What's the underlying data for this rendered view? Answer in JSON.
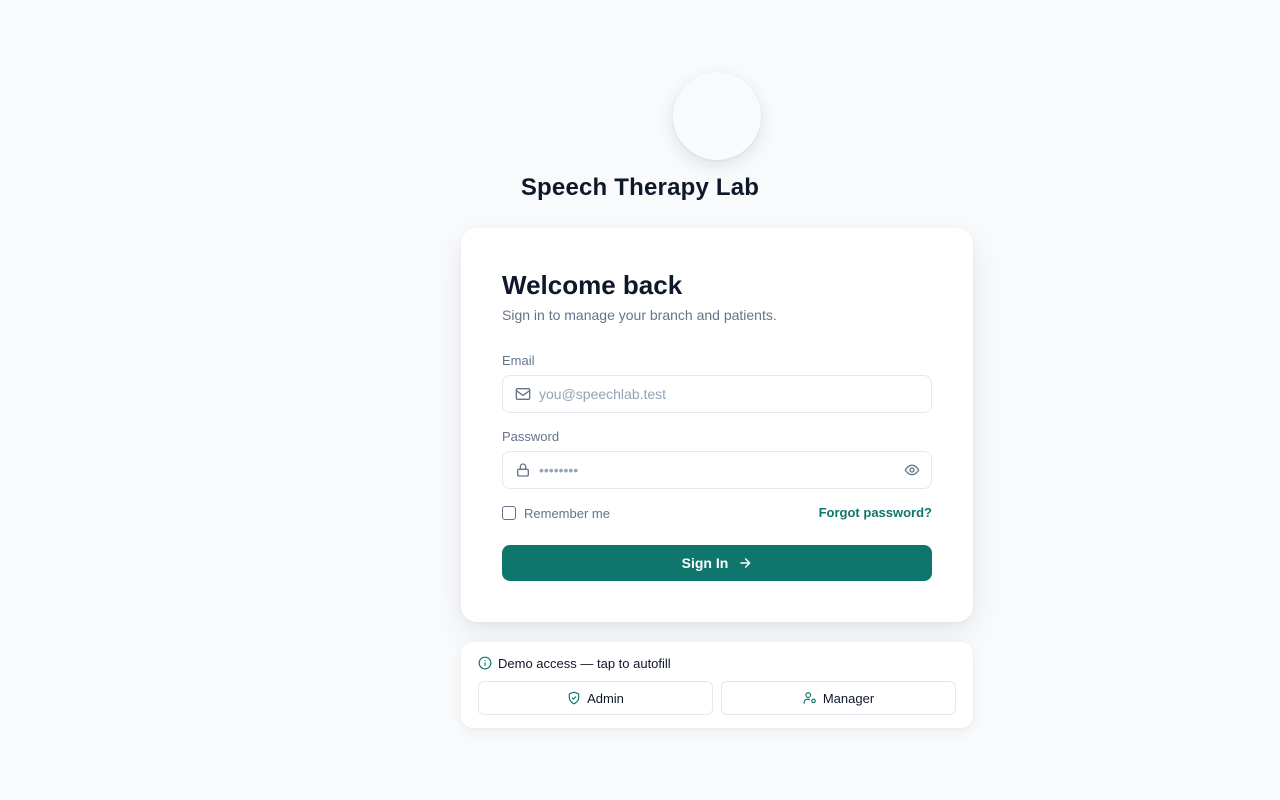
{
  "brand": {
    "app_name": "Speech Therapy Lab"
  },
  "login": {
    "heading": "Welcome back",
    "subheading": "Sign in to manage your branch and patients.",
    "email_label": "Email",
    "email_placeholder": "you@speechlab.test",
    "email_value": "",
    "password_label": "Password",
    "password_placeholder": "••••••••",
    "password_value": "",
    "remember_label": "Remember me",
    "remember_checked": false,
    "forgot_label": "Forgot password?",
    "submit_label": "Sign In"
  },
  "demo": {
    "title": "Demo access — tap to autofill",
    "buttons": [
      {
        "label": "Admin",
        "icon": "shield-check-icon"
      },
      {
        "label": "Manager",
        "icon": "user-cog-icon"
      }
    ]
  },
  "colors": {
    "accent": "#0f766e",
    "background": "#f8fafc",
    "text_primary": "#0f172a",
    "text_muted": "#64748b"
  }
}
